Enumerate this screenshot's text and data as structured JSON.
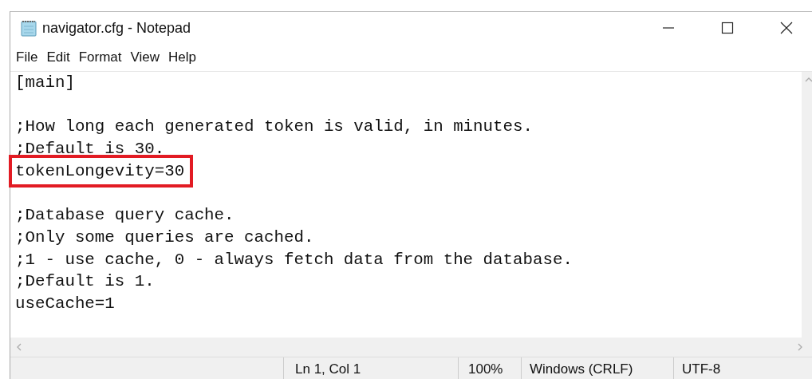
{
  "window": {
    "title": "navigator.cfg - Notepad"
  },
  "menu": [
    "File",
    "Edit",
    "Format",
    "View",
    "Help"
  ],
  "lines": [
    {
      "kind": "text",
      "text": "[main]",
      "highlighted": false
    },
    {
      "kind": "blank"
    },
    {
      "kind": "text",
      "text": ";How long each generated token is valid, in minutes.",
      "highlighted": false
    },
    {
      "kind": "text",
      "text": ";Default is 30.",
      "highlighted": false
    },
    {
      "kind": "text",
      "text": "tokenLongevity=30",
      "highlighted": true
    },
    {
      "kind": "blank"
    },
    {
      "kind": "text",
      "text": ";Database query cache.",
      "highlighted": false
    },
    {
      "kind": "text",
      "text": ";Only some queries are cached.",
      "highlighted": false
    },
    {
      "kind": "text",
      "text": ";1 - use cache, 0 - always fetch data from the database.",
      "highlighted": false
    },
    {
      "kind": "text",
      "text": ";Default is 1.",
      "highlighted": false
    },
    {
      "kind": "text",
      "text": "useCache=1",
      "highlighted": false
    }
  ],
  "status_bar": [
    "Ln 1, Col 1",
    "100%",
    "Windows (CRLF)",
    "UTF-8"
  ]
}
